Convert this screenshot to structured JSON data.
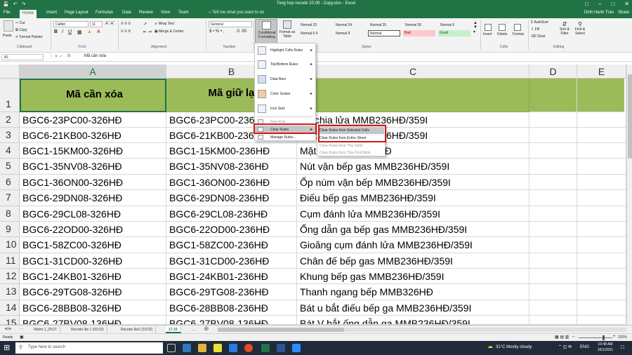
{
  "window": {
    "title": "Tong hop recode 20.09 - Copy.xlsx - Excel",
    "user": "Dinh Hanh Tran",
    "share": "Share"
  },
  "tabs": [
    "File",
    "Home",
    "Insert",
    "Page Layout",
    "Formulas",
    "Data",
    "Review",
    "View",
    "Team"
  ],
  "tell_me": "Tell me what you want to do",
  "ribbon": {
    "clipboard": {
      "paste": "Paste",
      "cut": "Cut",
      "copy": "Copy",
      "format_painter": "Format Painter",
      "label": "Clipboard"
    },
    "font": {
      "name": "Calibri",
      "size": "11",
      "label": "Font"
    },
    "alignment": {
      "wrap": "Wrap Text",
      "merge": "Merge & Center",
      "label": "Alignment"
    },
    "number": {
      "format": "General",
      "label": "Number"
    },
    "conditional_formatting": "Conditional Formatting",
    "format_as_table": "Format as Table",
    "styles": {
      "cells": [
        "Normal 23",
        "Normal 24",
        "Normal 25",
        "Normal 26",
        "Normal 6",
        "Normal 6 4",
        "Normal 9",
        "Normal",
        "Bad",
        "Good"
      ],
      "label": "Styles"
    },
    "cells": {
      "insert": "Insert",
      "delete": "Delete",
      "format": "Format",
      "label": "Cells"
    },
    "editing": {
      "autosum": "AutoSum",
      "fill": "Fill",
      "clear": "Clear",
      "sort": "Sort & Filter",
      "find": "Find & Select",
      "label": "Editing"
    }
  },
  "formula_bar": {
    "name_box": "A1",
    "fx": "fx",
    "formula": "Mã cần xóa"
  },
  "columns": [
    "A",
    "B",
    "C",
    "D",
    "E"
  ],
  "rows": [
    {
      "num": "1",
      "a": "Mã cần xóa",
      "b": "Mã giữ lại",
      "c": ""
    },
    {
      "num": "2",
      "a": "BGC6-23PC00-326HĐ",
      "b": "BGC6-23PC00-236HĐ",
      "c": "Bộ chia lửa MMB236HĐ/359I"
    },
    {
      "num": "3",
      "a": "BGC6-21KB00-326HĐ",
      "b": "BGC6-21KB00-236HĐ",
      "c": "Bộ chia lửa MMB236HĐ/359I"
    },
    {
      "num": "4",
      "a": "BGC1-15KM00-326HĐ",
      "b": "BGC1-15KM00-236HĐ",
      "c": "Mặt bếp MMB326HĐ"
    },
    {
      "num": "5",
      "a": "BGC1-35NV08-326HĐ",
      "b": "BGC1-35NV08-236HĐ",
      "c": "Nút vặn bếp gas MMB236HĐ/359I"
    },
    {
      "num": "6",
      "a": "BGC1-36ON00-326HĐ",
      "b": "BGC1-36ON00-236HĐ",
      "c": "Ốp núm vặn bếp MMB236HĐ/359I"
    },
    {
      "num": "7",
      "a": "BGC6-29DN08-326HĐ",
      "b": "BGC6-29DN08-236HĐ",
      "c": "Điếu bếp gas MMB236HĐ/359I"
    },
    {
      "num": "8",
      "a": "BGC6-29CL08-326HĐ",
      "b": "BGC6-29CL08-236HĐ",
      "c": "Cụm đánh lửa MMB236HĐ/359I"
    },
    {
      "num": "9",
      "a": "BGC6-22OD00-326HĐ",
      "b": "BGC6-22OD00-236HĐ",
      "c": "Ống dẫn ga bếp gas MMB236HĐ/359I"
    },
    {
      "num": "10",
      "a": "BGC1-58ZC00-326HĐ",
      "b": "BGC1-58ZC00-236HĐ",
      "c": "Gioăng cụm đánh lửa MMB236HĐ/359I"
    },
    {
      "num": "11",
      "a": "BGC1-31CD00-326HĐ",
      "b": "BGC1-31CD00-236HĐ",
      "c": "Chân đế bếp gas MMB236HĐ/359I"
    },
    {
      "num": "12",
      "a": "BGC1-24KB01-326HĐ",
      "b": "BGC1-24KB01-236HĐ",
      "c": "Khung bếp gas MMB236HĐ/359I"
    },
    {
      "num": "13",
      "a": "BGC6-29TG08-326HĐ",
      "b": "BGC6-29TG08-236HĐ",
      "c": "Thanh ngang bếp MMB326HĐ"
    },
    {
      "num": "14",
      "a": "BGC6-28BB08-326HĐ",
      "b": "BGC6-28BB08-236HĐ",
      "c": "Bát u bắt điếu bếp ga MMB236HĐ/359I"
    },
    {
      "num": "15",
      "a": "BGC6-27BV08-136HĐ",
      "b": "BGC6-27BV08-136HĐ",
      "c": "Bát V bắt ống dẫn ga MMB236HĐ/359I"
    }
  ],
  "menu": {
    "items": [
      "Highlight Cells Rules",
      "Top/Bottom Rules",
      "Data Bars",
      "Color Scales",
      "Icon Sets",
      "New Rule...",
      "Clear Rules",
      "Manage Rules..."
    ],
    "sub": [
      "Clear Rules from Selected Cells",
      "Clear Rules from Entire Sheet",
      "Clear Rules from This Table",
      "Clear Rules from This PivotTable"
    ]
  },
  "sheets": [
    "Nhóm 1_29.07",
    "Recode lần 1 (03.02)",
    "Recode lần2 (19.02)",
    "17.10"
  ],
  "status": {
    "ready": "Ready",
    "zoom": "232%"
  },
  "taskbar": {
    "search": "Type here to search",
    "weather": "31°C  Mostly cloudy",
    "lang": "ENG",
    "time": "10:48 AM",
    "date": "10/1/2021"
  },
  "colors": {
    "excel_green": "#217346",
    "header_fill": "#9bbb59",
    "highlight_red": "#d11919"
  }
}
